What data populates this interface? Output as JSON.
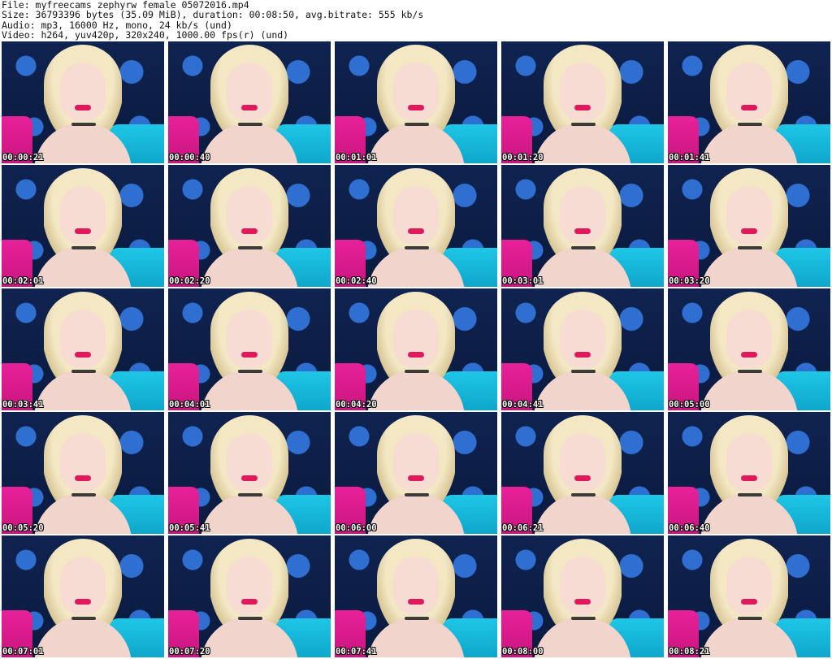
{
  "header": {
    "file_line": "File: myfreecams_zephyrw_female_05072016.mp4",
    "size_line": "Size: 36793396 bytes (35.09 MiB), duration: 00:08:50, avg.bitrate: 555 kb/s",
    "audio_line": "Audio: mp3, 16000 Hz, mono, 24 kb/s (und)",
    "video_line": "Video: h264, yuv420p, 320x240, 1000.00 fps(r) (und)"
  },
  "frames": [
    {
      "timestamp": "00:00:21"
    },
    {
      "timestamp": "00:00:40"
    },
    {
      "timestamp": "00:01:01"
    },
    {
      "timestamp": "00:01:20"
    },
    {
      "timestamp": "00:01:41"
    },
    {
      "timestamp": "00:02:01"
    },
    {
      "timestamp": "00:02:20"
    },
    {
      "timestamp": "00:02:40"
    },
    {
      "timestamp": "00:03:01"
    },
    {
      "timestamp": "00:03:20"
    },
    {
      "timestamp": "00:03:41"
    },
    {
      "timestamp": "00:04:01"
    },
    {
      "timestamp": "00:04:20"
    },
    {
      "timestamp": "00:04:41"
    },
    {
      "timestamp": "00:05:00"
    },
    {
      "timestamp": "00:05:20"
    },
    {
      "timestamp": "00:05:41"
    },
    {
      "timestamp": "00:06:00"
    },
    {
      "timestamp": "00:06:21"
    },
    {
      "timestamp": "00:06:40"
    },
    {
      "timestamp": "00:07:01"
    },
    {
      "timestamp": "00:07:20"
    },
    {
      "timestamp": "00:07:41"
    },
    {
      "timestamp": "00:08:00"
    },
    {
      "timestamp": "00:08:21"
    }
  ],
  "colors": {
    "background": "#ffffff",
    "header_text": "#111111",
    "timestamp_text": "#ffffff",
    "wallpaper": "#0f2350",
    "flower": "#2f6fd1",
    "pillow_pink": "#e8209a",
    "pillow_cyan": "#1ec6e6"
  }
}
